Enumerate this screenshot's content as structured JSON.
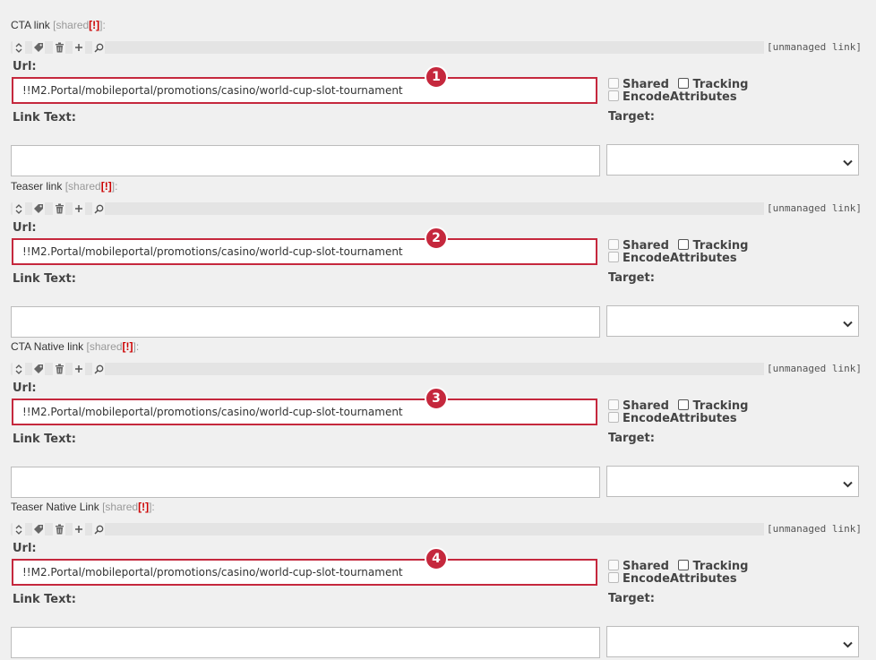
{
  "fields": [
    {
      "title": "CTA link",
      "shared_text": "[shared",
      "warn_text": "[!]",
      "close_text": "]:",
      "unmanaged": "[unmanaged link]",
      "url_label": "Url:",
      "url_value": "!!M2.Portal/mobileportal/promotions/casino/world-cup-slot-tournament",
      "badge": "1",
      "shared_label": "Shared",
      "tracking_label": "Tracking",
      "encode_label": "EncodeAttributes",
      "link_text_label": "Link Text:",
      "link_text_value": "",
      "target_label": "Target:",
      "target_value": ""
    },
    {
      "title": "Teaser link",
      "shared_text": "[shared",
      "warn_text": "[!]",
      "close_text": "]:",
      "unmanaged": "[unmanaged link]",
      "url_label": "Url:",
      "url_value": "!!M2.Portal/mobileportal/promotions/casino/world-cup-slot-tournament",
      "badge": "2",
      "shared_label": "Shared",
      "tracking_label": "Tracking",
      "encode_label": "EncodeAttributes",
      "link_text_label": "Link Text:",
      "link_text_value": "",
      "target_label": "Target:",
      "target_value": ""
    },
    {
      "title": "CTA Native link",
      "shared_text": "[shared",
      "warn_text": "[!]",
      "close_text": "]:",
      "unmanaged": "[unmanaged link]",
      "url_label": "Url:",
      "url_value": "!!M2.Portal/mobileportal/promotions/casino/world-cup-slot-tournament",
      "badge": "3",
      "shared_label": "Shared",
      "tracking_label": "Tracking",
      "encode_label": "EncodeAttributes",
      "link_text_label": "Link Text:",
      "link_text_value": "",
      "target_label": "Target:",
      "target_value": ""
    },
    {
      "title": "Teaser Native Link",
      "shared_text": "[shared",
      "warn_text": "[!]",
      "close_text": "]:",
      "unmanaged": "[unmanaged link]",
      "url_label": "Url:",
      "url_value": "!!M2.Portal/mobileportal/promotions/casino/world-cup-slot-tournament",
      "badge": "4",
      "shared_label": "Shared",
      "tracking_label": "Tracking",
      "encode_label": "EncodeAttributes",
      "link_text_label": "Link Text:",
      "link_text_value": "",
      "target_label": "Target:",
      "target_value": ""
    }
  ],
  "toolbar_icons": [
    "sort-icon",
    "tag-icon",
    "trash-icon",
    "plus-icon",
    "search-icon"
  ],
  "colors": {
    "highlight": "#c5283d",
    "warning": "#cc0000",
    "background": "#f0f0f0"
  }
}
